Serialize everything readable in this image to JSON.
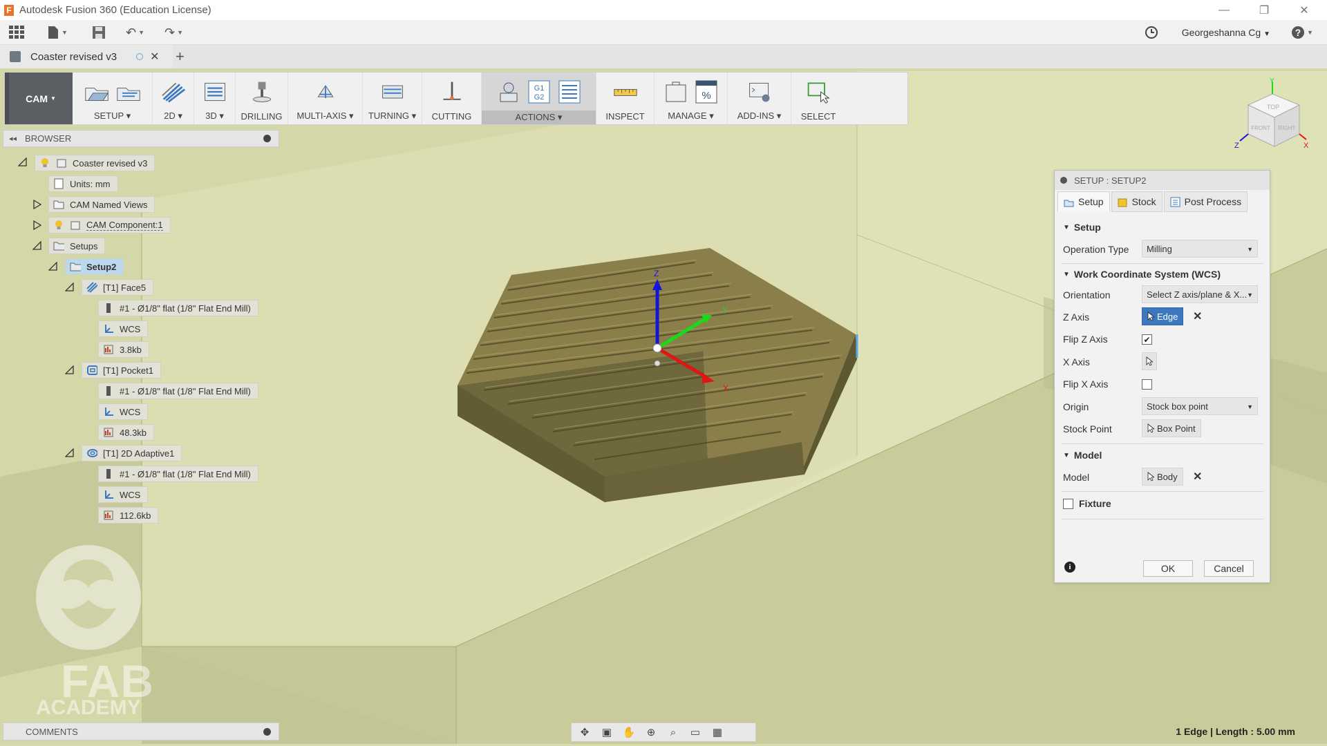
{
  "window": {
    "title": "Autodesk Fusion 360 (Education License)",
    "app_icon": "F"
  },
  "quick_access": {
    "user": "Georgeshanna Cg"
  },
  "document_tab": {
    "name": "Coaster revised v3"
  },
  "toolbar": {
    "workspace": "CAM",
    "groups": [
      {
        "label": "SETUP ▾"
      },
      {
        "label": "2D ▾"
      },
      {
        "label": "3D ▾"
      },
      {
        "label": "DRILLING"
      },
      {
        "label": "MULTI-AXIS ▾"
      },
      {
        "label": "TURNING ▾"
      },
      {
        "label": "CUTTING"
      },
      {
        "label": "ACTIONS ▾"
      },
      {
        "label": "INSPECT"
      },
      {
        "label": "MANAGE ▾"
      },
      {
        "label": "ADD-INS ▾"
      },
      {
        "label": "SELECT"
      }
    ],
    "actions_g_code": "G1 G2"
  },
  "browser": {
    "title": "BROWSER",
    "root": "Coaster revised v3",
    "units": "Units: mm",
    "named_views": "CAM Named Views",
    "component": "CAM Component:1",
    "setups": "Setups",
    "setup2": "Setup2",
    "ops": [
      {
        "name": "[T1] Face5",
        "tool": "#1 - Ø1/8\" flat (1/8\" Flat End Mill)",
        "wcs": "WCS",
        "size": "3.8kb"
      },
      {
        "name": "[T1] Pocket1",
        "tool": "#1 - Ø1/8\" flat (1/8\" Flat End Mill)",
        "wcs": "WCS",
        "size": "48.3kb"
      },
      {
        "name": "[T1] 2D Adaptive1",
        "tool": "#1 - Ø1/8\" flat (1/8\" Flat End Mill)",
        "wcs": "WCS",
        "size": "112.6kb"
      }
    ]
  },
  "watermark": {
    "line1": "FAB",
    "line2": "ACADEMY"
  },
  "comments": {
    "title": "COMMENTS"
  },
  "status": {
    "message": "1 Edge | Length : 5.00 mm"
  },
  "viewcube": {
    "top": "TOP",
    "front": "FRONT",
    "right": "RIGHT",
    "axis_y": "Y",
    "axis_z": "Z",
    "axis_x": "X"
  },
  "triad": {
    "z": "Z",
    "y": "Y",
    "x": "X"
  },
  "dialog": {
    "title": "SETUP : SETUP2",
    "tabs": {
      "setup": "Setup",
      "stock": "Stock",
      "post": "Post Process"
    },
    "section_setup": "Setup",
    "operation_type_label": "Operation Type",
    "operation_type_value": "Milling",
    "section_wcs": "Work Coordinate System (WCS)",
    "orientation_label": "Orientation",
    "orientation_value": "Select Z axis/plane & X...",
    "z_axis_label": "Z Axis",
    "z_axis_value": "Edge",
    "flip_z_label": "Flip Z Axis",
    "flip_z_checked": true,
    "x_axis_label": "X Axis",
    "flip_x_label": "Flip X Axis",
    "flip_x_checked": false,
    "origin_label": "Origin",
    "origin_value": "Stock box point",
    "stock_point_label": "Stock Point",
    "stock_point_value": "Box Point",
    "section_model": "Model",
    "model_label": "Model",
    "model_value": "Body",
    "section_fixture": "Fixture",
    "ok": "OK",
    "cancel": "Cancel"
  },
  "colors": {
    "workspace_bg": "#5b5f63",
    "accent_blue": "#3b78c0",
    "stock_yellow": "#d4d7a8",
    "part_olive": "#7a7040"
  }
}
